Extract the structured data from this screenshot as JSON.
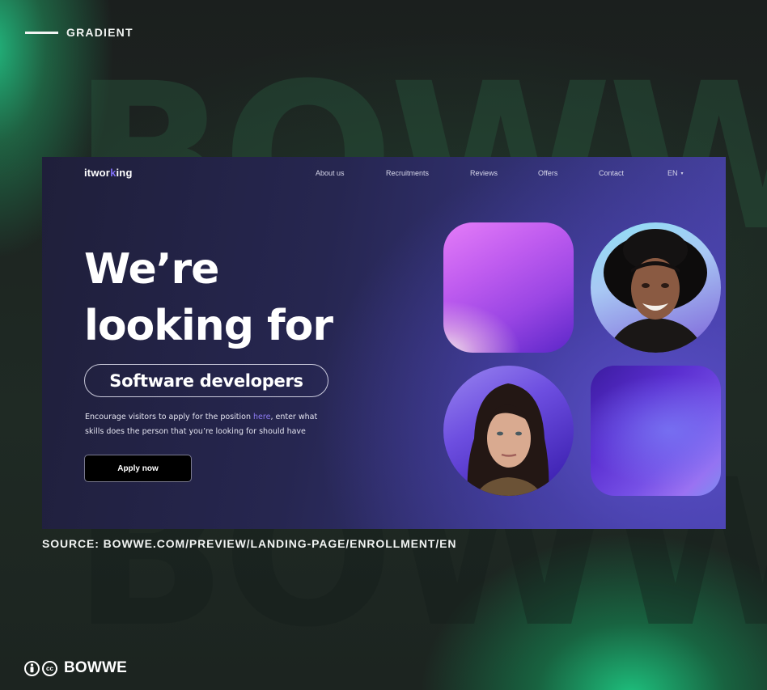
{
  "tag": {
    "text": "GRADIENT"
  },
  "background_watermark": [
    "BOWWE",
    "BOWWE"
  ],
  "preview": {
    "logo": {
      "prefix": "itwor",
      "highlight": "k",
      "suffix": "ing"
    },
    "nav": {
      "items": [
        "About us",
        "Recruitments",
        "Reviews",
        "Offers",
        "Contact"
      ],
      "language": "EN",
      "language_caret": "▾"
    },
    "hero": {
      "headline_line1": "We’re",
      "headline_line2": "looking for",
      "role_pill": "Software developers",
      "description_before": "Encourage visitors to apply for the position ",
      "description_link": "here",
      "description_after": ", enter what skills does the person that you’re looking for should have",
      "cta_label": "Apply now"
    },
    "colors": {
      "link": "#8e7cf5",
      "logo_accent": "#7c6cf0"
    }
  },
  "source": {
    "text": "SOURCE: BOWWE.COM/PREVIEW/LANDING-PAGE/ENROLLMENT/EN"
  },
  "footer": {
    "cc_by_icon": "person-icon",
    "cc_label": "cc",
    "brand": "BOWWE"
  }
}
